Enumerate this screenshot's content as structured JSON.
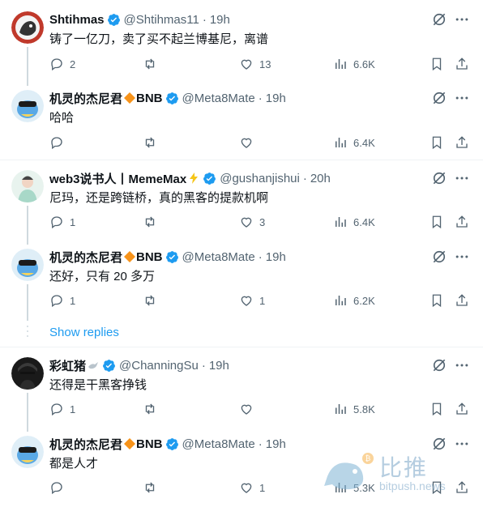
{
  "tweets": [
    {
      "name": "Shtihmas",
      "handle": "@Shtihmas11",
      "time": "19h",
      "text": "铸了一亿刀，卖了买不起兰博基尼，离谱",
      "replies": "2",
      "retweets": "",
      "likes": "13",
      "views": "6.6K",
      "avatar_color": "#c0392b"
    },
    {
      "name": "机灵的杰尼君",
      "badge_text": "BNB",
      "handle": "@Meta8Mate",
      "time": "19h",
      "text": "哈哈",
      "replies": "",
      "retweets": "",
      "likes": "",
      "views": "6.4K",
      "avatar_color": "#5aa9e6"
    },
    {
      "name": "web3说书人丨MemeMax",
      "handle": "@gushanjishui",
      "time": "20h",
      "text": "尼玛，还是跨链桥，真的黑客的提款机啊",
      "replies": "1",
      "retweets": "",
      "likes": "3",
      "views": "6.4K",
      "avatar_color": "#a8d8c8"
    },
    {
      "name": "机灵的杰尼君",
      "badge_text": "BNB",
      "handle": "@Meta8Mate",
      "time": "19h",
      "text": "还好，只有 20 多万",
      "replies": "1",
      "retweets": "",
      "likes": "1",
      "views": "6.2K",
      "avatar_color": "#5aa9e6"
    },
    {
      "name": "彩虹猪",
      "handle": "@ChanningSu",
      "time": "19h",
      "text": "还得是干黑客挣钱",
      "replies": "1",
      "retweets": "",
      "likes": "",
      "views": "5.8K",
      "avatar_color": "#222222"
    },
    {
      "name": "机灵的杰尼君",
      "badge_text": "BNB",
      "handle": "@Meta8Mate",
      "time": "19h",
      "text": "都是人才",
      "replies": "",
      "retweets": "",
      "likes": "1",
      "views": "5.3K",
      "avatar_color": "#5aa9e6"
    }
  ],
  "show_replies": "Show replies",
  "watermark": {
    "cn": "比推",
    "en": "bitpush.news"
  },
  "colors": {
    "accent": "#1d9bf0",
    "muted": "#536471",
    "diamond": "#f7931a"
  }
}
